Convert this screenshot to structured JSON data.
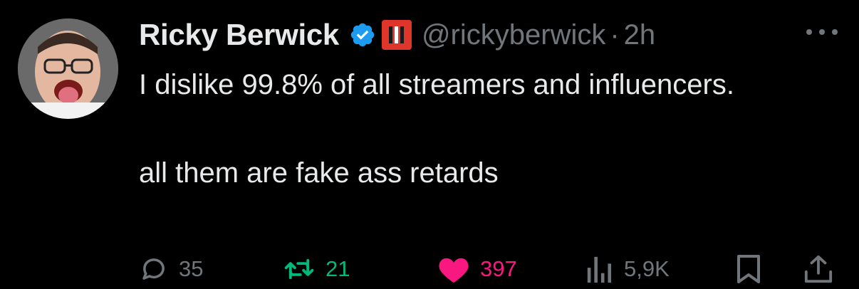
{
  "tweet": {
    "author": {
      "display_name": "Ricky Berwick",
      "handle": "@rickyberwick",
      "verified": true,
      "affiliation_badge_color": "#e0352b"
    },
    "separator": "·",
    "time": "2h",
    "text_lines": {
      "para1": "I dislike 99.8% of all streamers and influencers.",
      "para2": "all them are fake ass retards"
    },
    "actions": {
      "replies": "35",
      "retweets": "21",
      "likes": "397",
      "views": "5,9K"
    }
  },
  "colors": {
    "background": "#000000",
    "text_primary": "#e7e9ea",
    "text_secondary": "#71767b",
    "verified_blue": "#1d9bf0",
    "retweet_green": "#00ba7c",
    "like_pink": "#f91880"
  },
  "icons": [
    "avatar-photo",
    "verified-badge-icon",
    "affiliation-badge-icon",
    "more-icon",
    "reply-icon",
    "retweet-icon",
    "like-icon",
    "views-icon",
    "bookmark-icon",
    "share-icon"
  ]
}
